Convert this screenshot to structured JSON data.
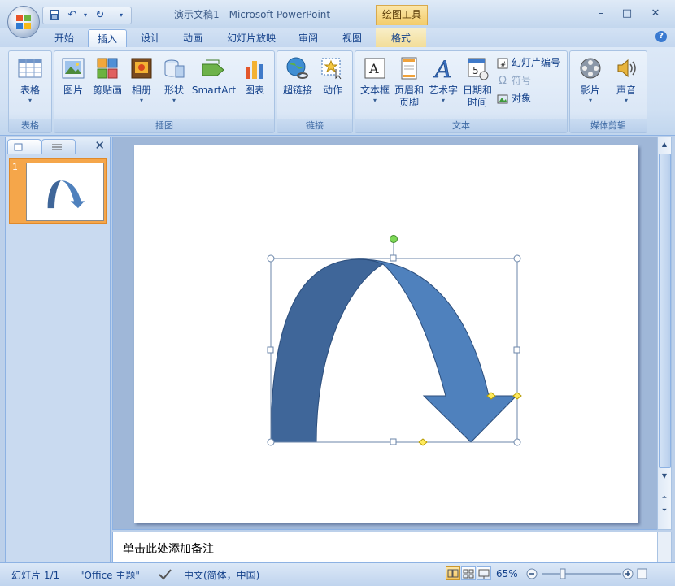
{
  "window": {
    "title": "演示文稿1 - Microsoft PowerPoint",
    "context_tab": "绘图工具",
    "controls": [
      "–",
      "□",
      "✕"
    ]
  },
  "tabs": [
    {
      "label": "开始",
      "active": false
    },
    {
      "label": "插入",
      "active": true
    },
    {
      "label": "设计",
      "active": false
    },
    {
      "label": "动画",
      "active": false
    },
    {
      "label": "幻灯片放映",
      "active": false
    },
    {
      "label": "审阅",
      "active": false
    },
    {
      "label": "视图",
      "active": false
    },
    {
      "label": "格式",
      "active": false
    }
  ],
  "help_label": "?",
  "ribbon": {
    "groups": [
      {
        "label": "表格",
        "buttons": [
          "表格"
        ]
      },
      {
        "label": "插图",
        "buttons": [
          "图片",
          "剪贴画",
          "相册",
          "形状",
          "SmartArt",
          "图表"
        ]
      },
      {
        "label": "链接",
        "buttons": [
          "超链接",
          "动作"
        ]
      },
      {
        "label": "文本",
        "buttons": [
          "文本框",
          "页眉和页脚",
          "艺术字",
          "日期和时间"
        ],
        "small": [
          "幻灯片编号",
          "符号",
          "对象"
        ]
      },
      {
        "label": "媒体剪辑",
        "buttons": [
          "影片",
          "声音"
        ]
      }
    ]
  },
  "slides_pane": {
    "thumb_number": "1",
    "close": "✕"
  },
  "notes_placeholder": "单击此处添加备注",
  "status": {
    "slide_info": "幻灯片 1/1",
    "theme": "\"Office 主题\"",
    "language": "中文(简体，中国)",
    "zoom": "65%"
  },
  "colors": {
    "arrow_dark": "#3f6699",
    "arrow_light": "#4f81bd",
    "accent_orange": "#f5a64a"
  }
}
